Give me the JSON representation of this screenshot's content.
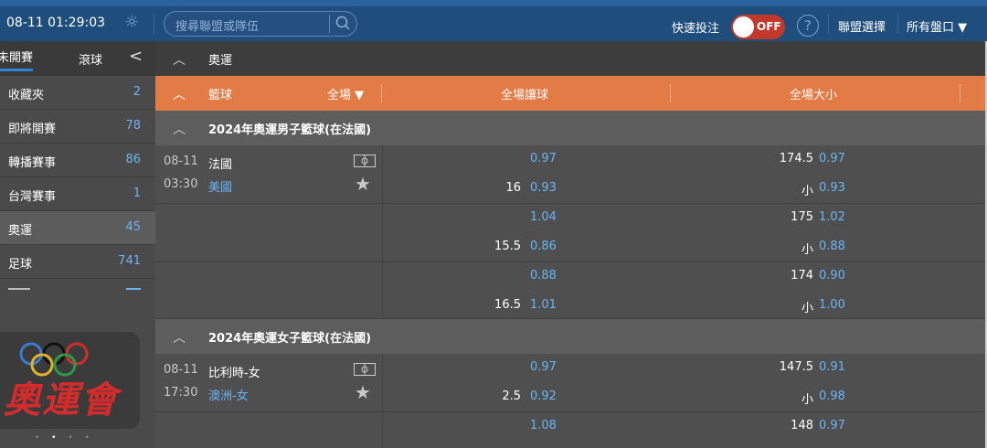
{
  "topbar": {
    "datetime": "08-11  01:29:03",
    "search_placeholder": "搜尋聯盟或隊伍",
    "quick_bet_label": "快速投注",
    "toggle_state": "OFF",
    "help_symbol": "?",
    "league_select": "聯盟選擇",
    "all_markets": "所有盤口 ▼",
    "brand_color": "#1f4e7d",
    "toggle_color": "#c0392b"
  },
  "sidebar": {
    "tab_early": "未開賽",
    "tab_live": "滾球",
    "collapse_icon": "chevron-left-icon",
    "items": [
      {
        "label": "收藏夾",
        "count": "2"
      },
      {
        "label": "即將開賽",
        "count": "78"
      },
      {
        "label": "轉播賽事",
        "count": "86"
      },
      {
        "label": "台灣賽事",
        "count": "1"
      },
      {
        "label": "奧運",
        "count": "45"
      },
      {
        "label": "足球",
        "count": "741"
      }
    ],
    "banner_text": "奧運會"
  },
  "main": {
    "section_title": "奧運",
    "header": {
      "sport": "籃球",
      "period": "全場",
      "period_arrow": "▼",
      "handicap": "全場讓球",
      "over_under": "全場大小",
      "accent": "#e37b46"
    },
    "leagues": [
      {
        "name": "2024年奧運男子籃球(在法國)",
        "match": {
          "date": "08-11",
          "time": "03:30",
          "home": "法國",
          "away": "美國"
        },
        "lines": [
          {
            "hcp_line": "",
            "hcp_odds": "0.97",
            "ou_line": "174.5",
            "ou_odds": "0.97"
          },
          {
            "hcp_line": "16",
            "hcp_odds": "0.93",
            "ou_line": "小",
            "ou_odds": "0.93"
          },
          {
            "hcp_line": "",
            "hcp_odds": "1.04",
            "ou_line": "175",
            "ou_odds": "1.02"
          },
          {
            "hcp_line": "15.5",
            "hcp_odds": "0.86",
            "ou_line": "小",
            "ou_odds": "0.88"
          },
          {
            "hcp_line": "",
            "hcp_odds": "0.88",
            "ou_line": "174",
            "ou_odds": "0.90"
          },
          {
            "hcp_line": "16.5",
            "hcp_odds": "1.01",
            "ou_line": "小",
            "ou_odds": "1.00"
          }
        ]
      },
      {
        "name": "2024年奧運女子籃球(在法國)",
        "match": {
          "date": "08-11",
          "time": "17:30",
          "home": "比利時-女",
          "away": "澳洲-女"
        },
        "lines": [
          {
            "hcp_line": "",
            "hcp_odds": "0.97",
            "ou_line": "147.5",
            "ou_odds": "0.91"
          },
          {
            "hcp_line": "2.5",
            "hcp_odds": "0.92",
            "ou_line": "小",
            "ou_odds": "0.98"
          },
          {
            "hcp_line": "",
            "hcp_odds": "1.08",
            "ou_line": "148",
            "ou_odds": "0.97"
          }
        ]
      }
    ]
  }
}
